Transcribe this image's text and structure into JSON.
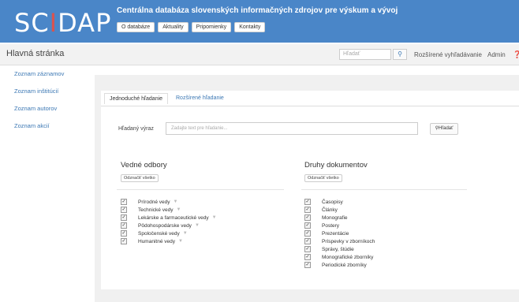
{
  "brand": {
    "logo_text_a": "SC",
    "logo_dot": "I",
    "logo_text_b": "DAP",
    "tagline": "Centrálna databáza slovenských informačných zdrojov pre výskum a vývoj"
  },
  "topnav": [
    "O databáze",
    "Aktuality",
    "Pripomienky",
    "Kontakty"
  ],
  "subheader": {
    "page_title": "Hlavná stránka",
    "search_placeholder": "Hľadať",
    "advanced_link": "Rozšírené vyhľadávanie",
    "user": "Admin"
  },
  "sidebar": [
    "Zoznam záznamov",
    "Zoznam inštitúcií",
    "Zoznam autorov",
    "Zoznam akcií"
  ],
  "tabs": {
    "simple": "Jednoduché hľadanie",
    "advanced": "Rozšírené hľadanie"
  },
  "query": {
    "label": "Hľadaný výraz",
    "placeholder": "Zadajte text pre hľadanie...",
    "button": "Hľadať"
  },
  "fields": {
    "title": "Vedné odbory",
    "unselect": "Odznačiť všetko",
    "items": [
      "Prírodné vedy",
      "Technické vedy",
      "Lekárske a farmaceutické vedy",
      "Pôdohospodárske vedy",
      "Spoločenské vedy",
      "Humanitné vedy"
    ]
  },
  "doctypes": {
    "title": "Druhy dokumentov",
    "unselect": "Odznačiť všetko",
    "items": [
      "Časopisy",
      "Články",
      "Monografie",
      "Postery",
      "Prezentácie",
      "Príspevky v zborníkoch",
      "Správy, štúdie",
      "Monografické zborníky",
      "Periodické zborníky"
    ]
  },
  "colors": {
    "header": "#4a86c8",
    "link": "#3c78b4",
    "logo_dot": "#d9534f"
  }
}
